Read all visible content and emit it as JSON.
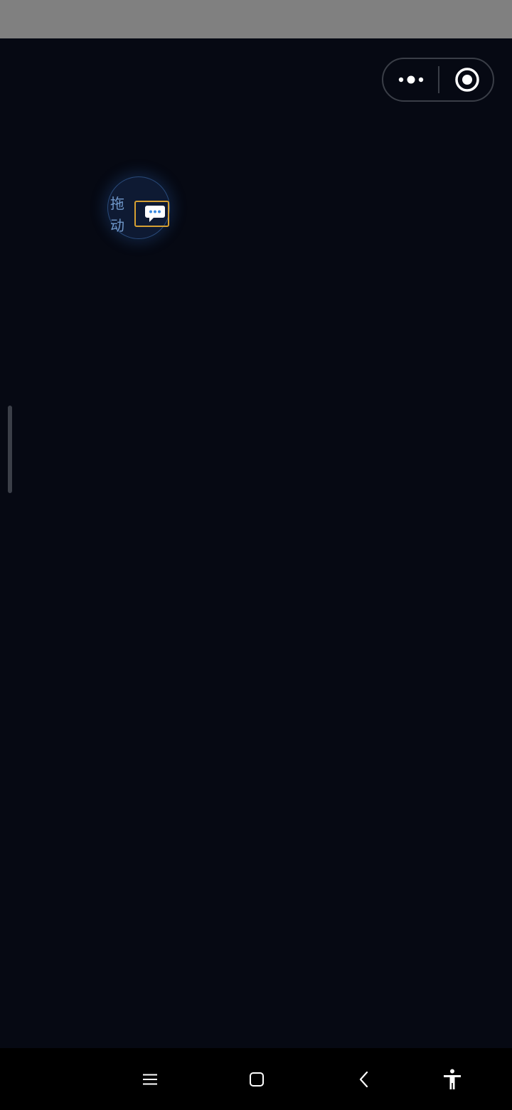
{
  "floating_button": {
    "label_line1": "拖",
    "label_line2": "动",
    "icon": "chat-bubble-icon"
  },
  "capsule": {
    "more_icon": "more-dots-icon",
    "close_icon": "target-close-icon"
  },
  "nav_bar": {
    "menu_icon": "menu-icon",
    "home_icon": "home-square-icon",
    "back_icon": "back-chevron-icon",
    "accessibility_icon": "accessibility-icon"
  },
  "colors": {
    "background": "#060913",
    "status_bar": "#808080",
    "nav_bar": "#000000",
    "accent_orange": "#d6a032",
    "accent_blue": "#6f97c9"
  }
}
